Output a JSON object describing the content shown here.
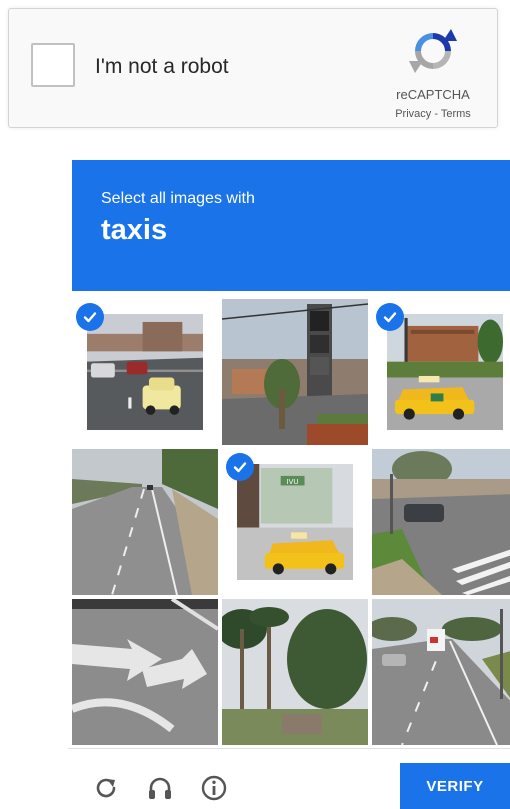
{
  "widget": {
    "label": "I'm not a robot",
    "brand_name": "reCAPTCHA",
    "privacy_label": "Privacy",
    "separator": " - ",
    "terms_label": "Terms"
  },
  "challenge": {
    "instruction": "Select all images with",
    "target": "taxis",
    "tiles": [
      {
        "id": 1,
        "content": "street-with-taxi",
        "selected": true
      },
      {
        "id": 2,
        "content": "storefront-sign",
        "selected": false
      },
      {
        "id": 3,
        "content": "taxi-parking-lot",
        "selected": true
      },
      {
        "id": 4,
        "content": "highway",
        "selected": false
      },
      {
        "id": 5,
        "content": "taxi-storefront",
        "selected": true,
        "sign_text": "IVU"
      },
      {
        "id": 6,
        "content": "crosswalk-intersection",
        "selected": false
      },
      {
        "id": 7,
        "content": "road-arrow-marking",
        "selected": false
      },
      {
        "id": 8,
        "content": "palm-trees",
        "selected": false
      },
      {
        "id": 9,
        "content": "road-with-truck",
        "selected": false
      }
    ],
    "verify_label": "VERIFY",
    "icons": [
      "reload-icon",
      "headphones-icon",
      "info-icon"
    ]
  },
  "colors": {
    "accent": "#1a73e8",
    "taxi_yellow": "#f2c21b",
    "widget_bg": "#f9f9f9"
  }
}
